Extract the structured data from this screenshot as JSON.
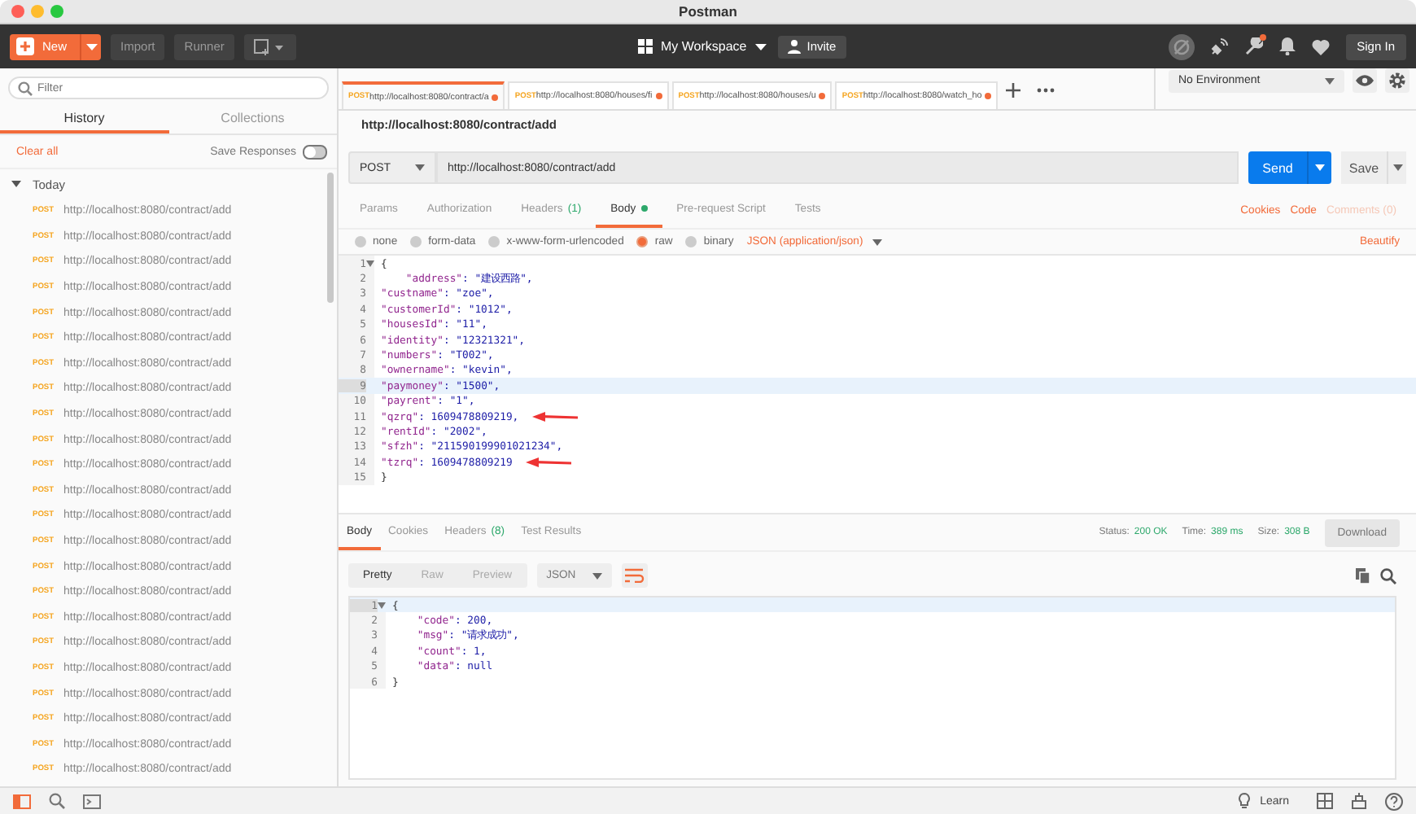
{
  "window": {
    "title": "Postman"
  },
  "toolbar": {
    "new": "New",
    "import": "Import",
    "runner": "Runner",
    "workspace": "My Workspace",
    "invite": "Invite",
    "sign_in": "Sign In",
    "notification": true
  },
  "sidebar": {
    "filter_placeholder": "Filter",
    "tabs": [
      {
        "label": "History",
        "selected": true
      },
      {
        "label": "Collections",
        "selected": false
      }
    ],
    "clear_all": "Clear all",
    "save_responses": "Save Responses",
    "save_responses_on": false,
    "group": {
      "label": "Today",
      "expanded": true,
      "items": [
        {
          "method": "POST",
          "url": "http://localhost:8080/contract/add"
        },
        {
          "method": "POST",
          "url": "http://localhost:8080/contract/add"
        },
        {
          "method": "POST",
          "url": "http://localhost:8080/contract/add"
        },
        {
          "method": "POST",
          "url": "http://localhost:8080/contract/add"
        },
        {
          "method": "POST",
          "url": "http://localhost:8080/contract/add"
        },
        {
          "method": "POST",
          "url": "http://localhost:8080/contract/add"
        },
        {
          "method": "POST",
          "url": "http://localhost:8080/contract/add"
        },
        {
          "method": "POST",
          "url": "http://localhost:8080/contract/add"
        },
        {
          "method": "POST",
          "url": "http://localhost:8080/contract/add"
        },
        {
          "method": "POST",
          "url": "http://localhost:8080/contract/add"
        },
        {
          "method": "POST",
          "url": "http://localhost:8080/contract/add"
        },
        {
          "method": "POST",
          "url": "http://localhost:8080/contract/add"
        },
        {
          "method": "POST",
          "url": "http://localhost:8080/contract/add"
        },
        {
          "method": "POST",
          "url": "http://localhost:8080/contract/add"
        },
        {
          "method": "POST",
          "url": "http://localhost:8080/contract/add"
        },
        {
          "method": "POST",
          "url": "http://localhost:8080/contract/add"
        },
        {
          "method": "POST",
          "url": "http://localhost:8080/contract/add"
        },
        {
          "method": "POST",
          "url": "http://localhost:8080/contract/add"
        },
        {
          "method": "POST",
          "url": "http://localhost:8080/contract/add"
        },
        {
          "method": "POST",
          "url": "http://localhost:8080/contract/add"
        },
        {
          "method": "POST",
          "url": "http://localhost:8080/contract/add"
        },
        {
          "method": "POST",
          "url": "http://localhost:8080/contract/add"
        },
        {
          "method": "POST",
          "url": "http://localhost:8080/contract/add"
        }
      ]
    }
  },
  "request_tabs": [
    {
      "method": "POST",
      "label": "http://localhost:8080/contract/a",
      "selected": true,
      "unsaved": true
    },
    {
      "method": "POST",
      "label": "http://localhost:8080/houses/fi",
      "selected": false,
      "unsaved": true
    },
    {
      "method": "POST",
      "label": "http://localhost:8080/houses/u",
      "selected": false,
      "unsaved": true
    },
    {
      "method": "POST",
      "label": "http://localhost:8080/watch_ho",
      "selected": false,
      "unsaved": true
    }
  ],
  "environment": "No Environment",
  "request": {
    "title": "http://localhost:8080/contract/add",
    "method": "POST",
    "url": "http://localhost:8080/contract/add",
    "send": "Send",
    "save": "Save",
    "tabs": [
      {
        "label": "Params",
        "selected": false,
        "dot": false
      },
      {
        "label": "Authorization",
        "selected": false,
        "dot": false
      },
      {
        "label": "Headers",
        "count": "(1)",
        "selected": false,
        "dot": false
      },
      {
        "label": "Body",
        "selected": true,
        "dot": true
      },
      {
        "label": "Pre-request Script",
        "selected": false,
        "dot": false
      },
      {
        "label": "Tests",
        "selected": false,
        "dot": false
      }
    ],
    "links": [
      {
        "label": "Cookies",
        "disabled": false
      },
      {
        "label": "Code",
        "disabled": false
      },
      {
        "label": "Comments (0)",
        "disabled": true
      }
    ],
    "body_modes": [
      {
        "label": "none",
        "selected": false
      },
      {
        "label": "form-data",
        "selected": false
      },
      {
        "label": "x-www-form-urlencoded",
        "selected": false
      },
      {
        "label": "raw",
        "selected": true
      },
      {
        "label": "binary",
        "selected": false
      }
    ],
    "content_type": "JSON (application/json)",
    "beautify": "Beautify",
    "body_lines": [
      {
        "no": "1",
        "value": "{",
        "foldable": true
      },
      {
        "no": "2",
        "key": "    \"address\"",
        "value": ": \"建设西路\","
      },
      {
        "no": "3",
        "key": "\"custname\"",
        "value": ": \"zoe\","
      },
      {
        "no": "4",
        "key": "\"customerId\"",
        "value": ": \"1012\","
      },
      {
        "no": "5",
        "key": "\"housesId\"",
        "value": ": \"11\","
      },
      {
        "no": "6",
        "key": "\"identity\"",
        "value": ": \"12321321\","
      },
      {
        "no": "7",
        "key": "\"numbers\"",
        "value": ": \"T002\","
      },
      {
        "no": "8",
        "key": "\"ownername\"",
        "value": ": \"kevin\","
      },
      {
        "no": "9",
        "key": "\"paymoney\"",
        "value": ": \"1500\",",
        "highlight": true
      },
      {
        "no": "10",
        "key": "\"payrent\"",
        "value": ": \"1\","
      },
      {
        "no": "11",
        "key": "\"qzrq\"",
        "value": ": 1609478809219,",
        "arrow": true
      },
      {
        "no": "12",
        "key": "\"rentId\"",
        "value": ": \"2002\","
      },
      {
        "no": "13",
        "key": "\"sfzh\"",
        "value": ": \"211590199901021234\","
      },
      {
        "no": "14",
        "key": "\"tzrq\"",
        "value": ": 1609478809219",
        "arrow": true
      },
      {
        "no": "15",
        "value": "}"
      }
    ]
  },
  "response": {
    "tabs": [
      {
        "label": "Body",
        "selected": true
      },
      {
        "label": "Cookies",
        "selected": false
      },
      {
        "label": "Headers",
        "count": "(8)",
        "selected": false
      },
      {
        "label": "Test Results",
        "selected": false
      }
    ],
    "stats": [
      {
        "label": "Status:",
        "value": "200 OK"
      },
      {
        "label": "Time:",
        "value": "389 ms"
      },
      {
        "label": "Size:",
        "value": "308 B"
      }
    ],
    "download": "Download",
    "views": [
      {
        "label": "Pretty",
        "selected": true
      },
      {
        "label": "Raw",
        "selected": false
      },
      {
        "label": "Preview",
        "selected": false
      }
    ],
    "format": "JSON",
    "lines": [
      {
        "no": "1",
        "value": "{",
        "foldable": true,
        "highlight": true
      },
      {
        "no": "2",
        "key": "    \"code\"",
        "value": ": 200,"
      },
      {
        "no": "3",
        "key": "    \"msg\"",
        "value": ": \"请求成功\","
      },
      {
        "no": "4",
        "key": "    \"count\"",
        "value": ": 1,"
      },
      {
        "no": "5",
        "key": "    \"data\"",
        "value": ": null"
      },
      {
        "no": "6",
        "value": "}"
      }
    ]
  },
  "status_bar": {
    "learn": "Learn"
  }
}
